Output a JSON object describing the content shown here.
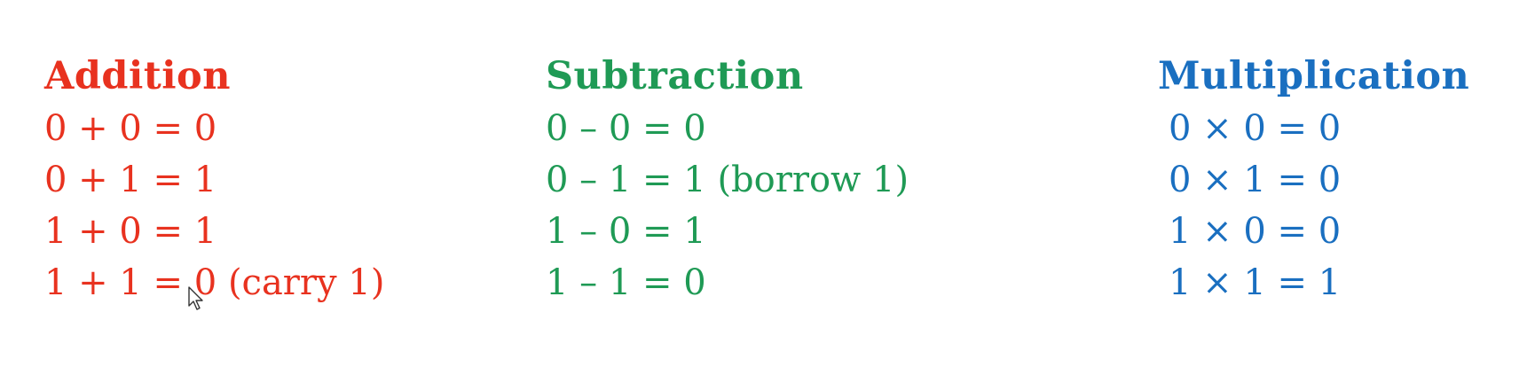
{
  "colors": {
    "addition": "#e8321f",
    "subtraction": "#1f9a55",
    "multiplication": "#1a6fc0"
  },
  "columns": [
    {
      "title": "Addition",
      "rows": [
        "0 + 0 = 0",
        "0 + 1 = 1",
        "1 + 0 = 1",
        "1 + 1 = 0 (carry 1)"
      ]
    },
    {
      "title": "Subtraction",
      "rows": [
        "0 – 0 = 0",
        "0 – 1 = 1 (borrow 1)",
        "1 – 0 = 1",
        "1 – 1 = 0"
      ]
    },
    {
      "title": "Multiplication",
      "rows": [
        "0 × 0 = 0",
        "0 × 1 = 0",
        "1 × 0 = 0",
        "1 × 1 = 1"
      ]
    }
  ],
  "cursor_icon": "mouse-pointer-icon"
}
